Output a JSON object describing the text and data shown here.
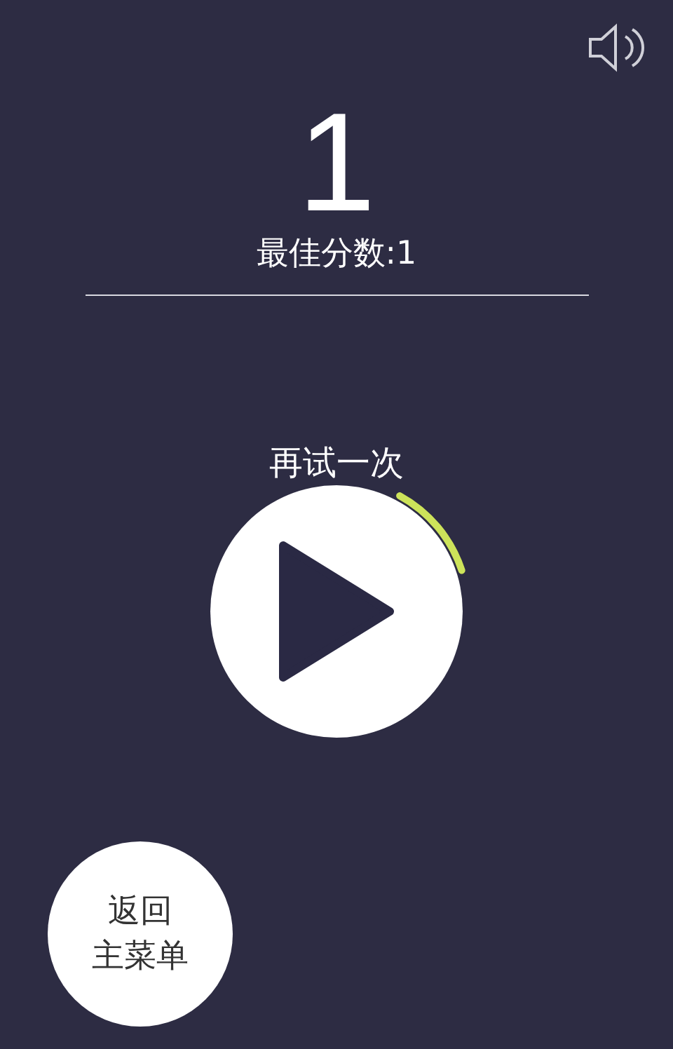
{
  "sound": {
    "muted": false
  },
  "score": "1",
  "best_score": "最佳分数:1",
  "retry": {
    "label": "再试一次"
  },
  "menu_button": {
    "lines": [
      "返回",
      "主菜单"
    ]
  }
}
